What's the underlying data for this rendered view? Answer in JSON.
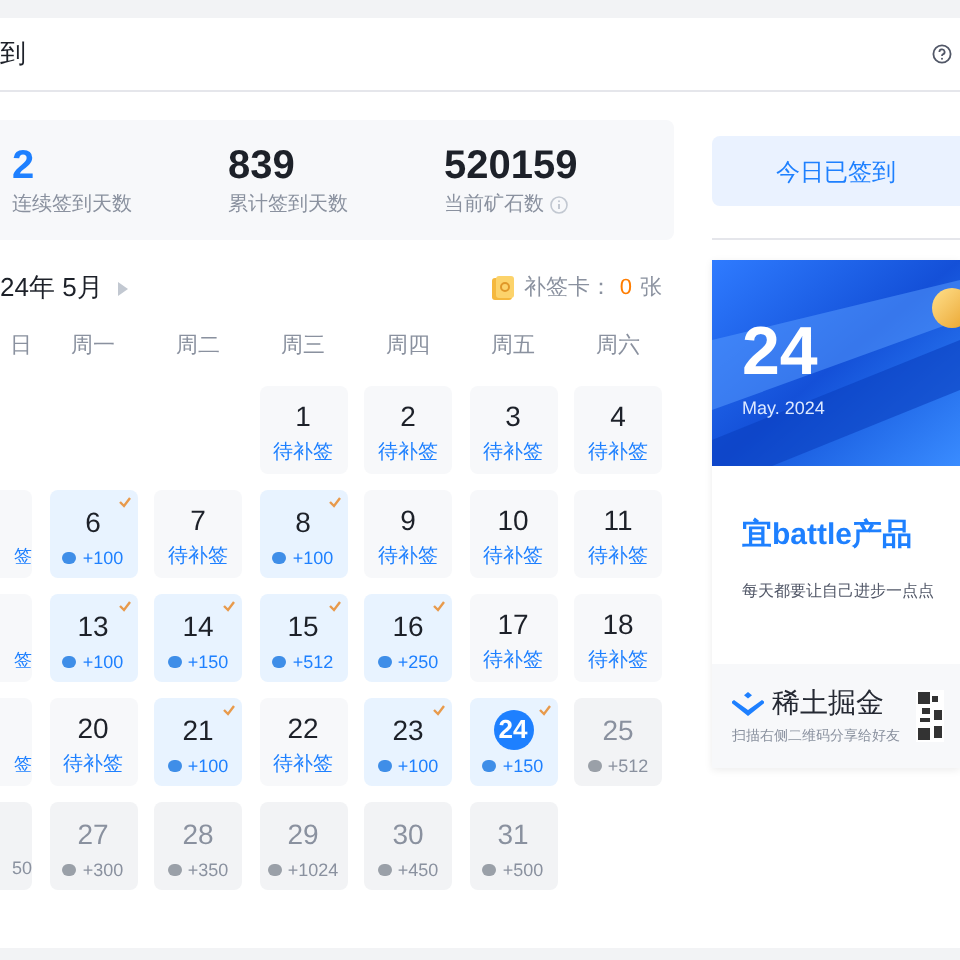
{
  "header": {
    "title": "到"
  },
  "stats": [
    {
      "value": "2",
      "label": "连续签到天数",
      "highlight": true,
      "info": false
    },
    {
      "value": "839",
      "label": "累计签到天数",
      "highlight": false,
      "info": false
    },
    {
      "value": "520159",
      "label": "当前矿石数",
      "highlight": false,
      "info": true
    }
  ],
  "calendar": {
    "month": "24年 5月",
    "makeup_label": "补签卡：",
    "makeup_count": "0",
    "makeup_unit": "张",
    "weekdays": [
      "日",
      "周一",
      "周二",
      "周三",
      "周四",
      "周五",
      "周六"
    ],
    "weeks": [
      [
        {
          "kind": "empty"
        },
        {
          "kind": "empty"
        },
        {
          "kind": "empty"
        },
        {
          "day": "1",
          "kind": "makeup",
          "text": "待补签",
          "selected": false
        },
        {
          "day": "2",
          "kind": "makeup",
          "text": "待补签",
          "selected": false
        },
        {
          "day": "3",
          "kind": "makeup",
          "text": "待补签",
          "selected": false
        },
        {
          "day": "4",
          "kind": "makeup",
          "text": "待补签",
          "selected": false
        }
      ],
      [
        {
          "kind": "makeup",
          "text": "签"
        },
        {
          "day": "6",
          "kind": "signed",
          "text": "+100",
          "selected": false
        },
        {
          "day": "7",
          "kind": "makeup",
          "text": "待补签",
          "selected": false
        },
        {
          "day": "8",
          "kind": "signed",
          "text": "+100",
          "selected": false
        },
        {
          "day": "9",
          "kind": "makeup",
          "text": "待补签",
          "selected": false
        },
        {
          "day": "10",
          "kind": "makeup",
          "text": "待补签",
          "selected": false
        },
        {
          "day": "11",
          "kind": "makeup",
          "text": "待补签",
          "selected": false
        }
      ],
      [
        {
          "kind": "makeup",
          "text": "签"
        },
        {
          "day": "13",
          "kind": "signed",
          "text": "+100",
          "selected": false
        },
        {
          "day": "14",
          "kind": "signed",
          "text": "+150",
          "selected": false
        },
        {
          "day": "15",
          "kind": "signed",
          "text": "+512",
          "selected": false
        },
        {
          "day": "16",
          "kind": "signed",
          "text": "+250",
          "selected": false
        },
        {
          "day": "17",
          "kind": "makeup",
          "text": "待补签",
          "selected": false
        },
        {
          "day": "18",
          "kind": "makeup",
          "text": "待补签",
          "selected": false
        }
      ],
      [
        {
          "kind": "makeup",
          "text": "签"
        },
        {
          "day": "20",
          "kind": "makeup",
          "text": "待补签",
          "selected": false
        },
        {
          "day": "21",
          "kind": "signed",
          "text": "+100",
          "selected": false
        },
        {
          "day": "22",
          "kind": "makeup",
          "text": "待补签",
          "selected": false
        },
        {
          "day": "23",
          "kind": "signed",
          "text": "+100",
          "selected": false
        },
        {
          "day": "24",
          "kind": "signed",
          "text": "+150",
          "selected": true
        },
        {
          "day": "25",
          "kind": "future",
          "text": "+512",
          "selected": false
        }
      ],
      [
        {
          "kind": "future",
          "text": "50"
        },
        {
          "day": "27",
          "kind": "future",
          "text": "+300",
          "selected": false
        },
        {
          "day": "28",
          "kind": "future",
          "text": "+350",
          "selected": false
        },
        {
          "day": "29",
          "kind": "future",
          "text": "+1024",
          "selected": false
        },
        {
          "day": "30",
          "kind": "future",
          "text": "+450",
          "selected": false
        },
        {
          "day": "31",
          "kind": "future",
          "text": "+500",
          "selected": false
        },
        {
          "kind": "empty"
        }
      ]
    ]
  },
  "side": {
    "button": "今日已签到",
    "card": {
      "day": "24",
      "date": "May. 2024",
      "title": "宜battle产品",
      "subtitle": "每天都要让自己进步一点点",
      "brand": "稀土掘金",
      "share": "扫描右侧二维码分享给好友"
    }
  }
}
